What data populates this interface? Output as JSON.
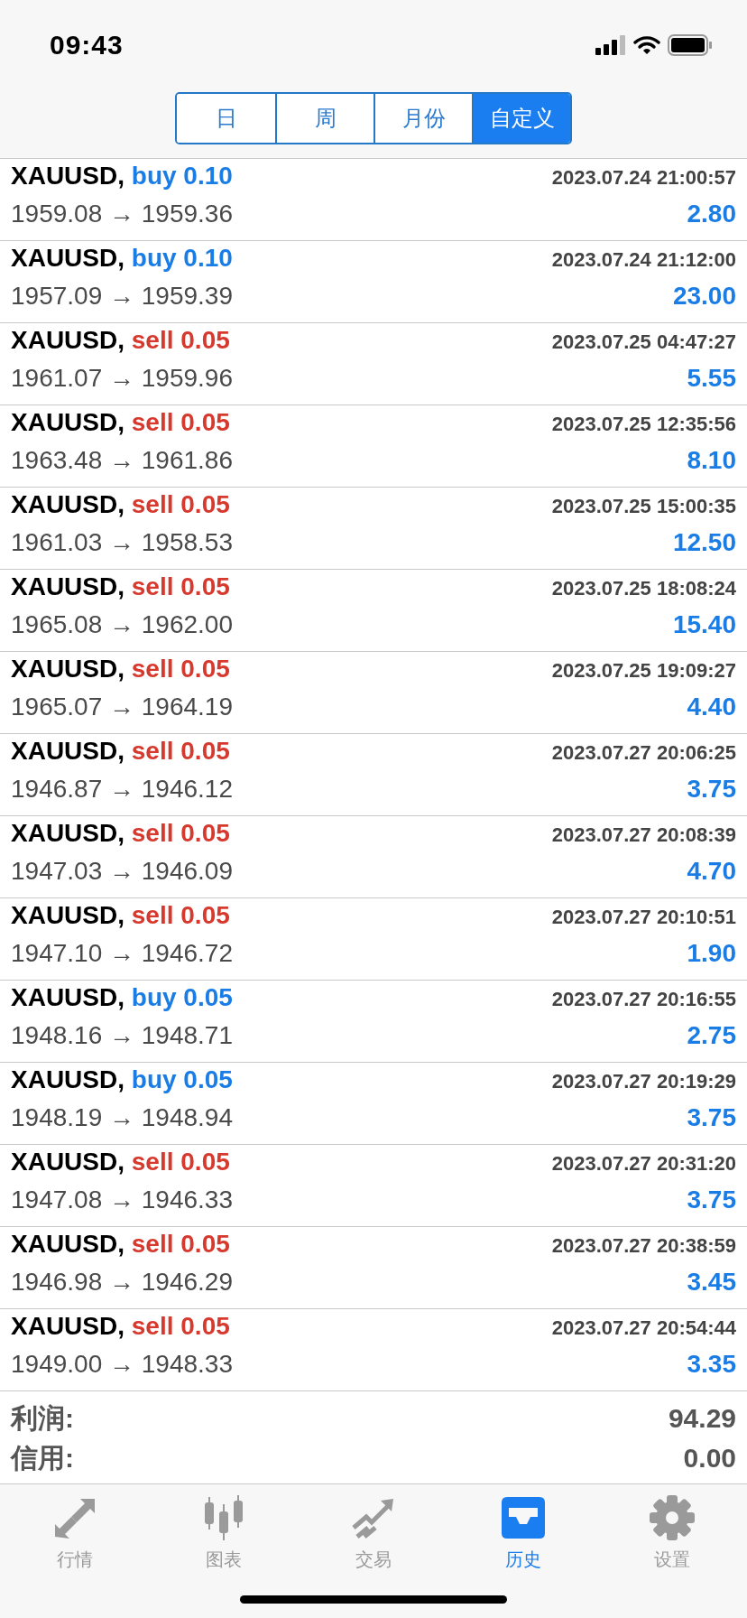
{
  "status_bar": {
    "time": "09:43"
  },
  "tabs": [
    {
      "label": "日",
      "selected": false
    },
    {
      "label": "周",
      "selected": false
    },
    {
      "label": "月份",
      "selected": false
    },
    {
      "label": "自定义",
      "selected": true
    }
  ],
  "deals": [
    {
      "symbol": "XAUUSD,",
      "side": "buy",
      "volume": "0.10",
      "time": "2023.07.24 21:00:57",
      "prices": "1959.08 → 1959.36",
      "profit": "2.80"
    },
    {
      "symbol": "XAUUSD,",
      "side": "buy",
      "volume": "0.10",
      "time": "2023.07.24 21:12:00",
      "prices": "1957.09 → 1959.39",
      "profit": "23.00"
    },
    {
      "symbol": "XAUUSD,",
      "side": "sell",
      "volume": "0.05",
      "time": "2023.07.25 04:47:27",
      "prices": "1961.07 → 1959.96",
      "profit": "5.55"
    },
    {
      "symbol": "XAUUSD,",
      "side": "sell",
      "volume": "0.05",
      "time": "2023.07.25 12:35:56",
      "prices": "1963.48 → 1961.86",
      "profit": "8.10"
    },
    {
      "symbol": "XAUUSD,",
      "side": "sell",
      "volume": "0.05",
      "time": "2023.07.25 15:00:35",
      "prices": "1961.03 → 1958.53",
      "profit": "12.50"
    },
    {
      "symbol": "XAUUSD,",
      "side": "sell",
      "volume": "0.05",
      "time": "2023.07.25 18:08:24",
      "prices": "1965.08 → 1962.00",
      "profit": "15.40"
    },
    {
      "symbol": "XAUUSD,",
      "side": "sell",
      "volume": "0.05",
      "time": "2023.07.25 19:09:27",
      "prices": "1965.07 → 1964.19",
      "profit": "4.40"
    },
    {
      "symbol": "XAUUSD,",
      "side": "sell",
      "volume": "0.05",
      "time": "2023.07.27 20:06:25",
      "prices": "1946.87 → 1946.12",
      "profit": "3.75"
    },
    {
      "symbol": "XAUUSD,",
      "side": "sell",
      "volume": "0.05",
      "time": "2023.07.27 20:08:39",
      "prices": "1947.03 → 1946.09",
      "profit": "4.70"
    },
    {
      "symbol": "XAUUSD,",
      "side": "sell",
      "volume": "0.05",
      "time": "2023.07.27 20:10:51",
      "prices": "1947.10 → 1946.72",
      "profit": "1.90"
    },
    {
      "symbol": "XAUUSD,",
      "side": "buy",
      "volume": "0.05",
      "time": "2023.07.27 20:16:55",
      "prices": "1948.16 → 1948.71",
      "profit": "2.75"
    },
    {
      "symbol": "XAUUSD,",
      "side": "buy",
      "volume": "0.05",
      "time": "2023.07.27 20:19:29",
      "prices": "1948.19 → 1948.94",
      "profit": "3.75"
    },
    {
      "symbol": "XAUUSD,",
      "side": "sell",
      "volume": "0.05",
      "time": "2023.07.27 20:31:20",
      "prices": "1947.08 → 1946.33",
      "profit": "3.75"
    },
    {
      "symbol": "XAUUSD,",
      "side": "sell",
      "volume": "0.05",
      "time": "2023.07.27 20:38:59",
      "prices": "1946.98 → 1946.29",
      "profit": "3.45"
    },
    {
      "symbol": "XAUUSD,",
      "side": "sell",
      "volume": "0.05",
      "time": "2023.07.27 20:54:44",
      "prices": "1949.00 → 1948.33",
      "profit": "3.35"
    }
  ],
  "summary": [
    {
      "label": "利润:",
      "value": "94.29"
    },
    {
      "label": "信用:",
      "value": "0.00"
    }
  ],
  "tab_bar": [
    {
      "label": "行情",
      "kind": "quotes",
      "selected": false
    },
    {
      "label": "图表",
      "kind": "chart",
      "selected": false
    },
    {
      "label": "交易",
      "kind": "trade",
      "selected": false
    },
    {
      "label": "历史",
      "kind": "history",
      "selected": true
    },
    {
      "label": "设置",
      "kind": "settings",
      "selected": false
    }
  ]
}
